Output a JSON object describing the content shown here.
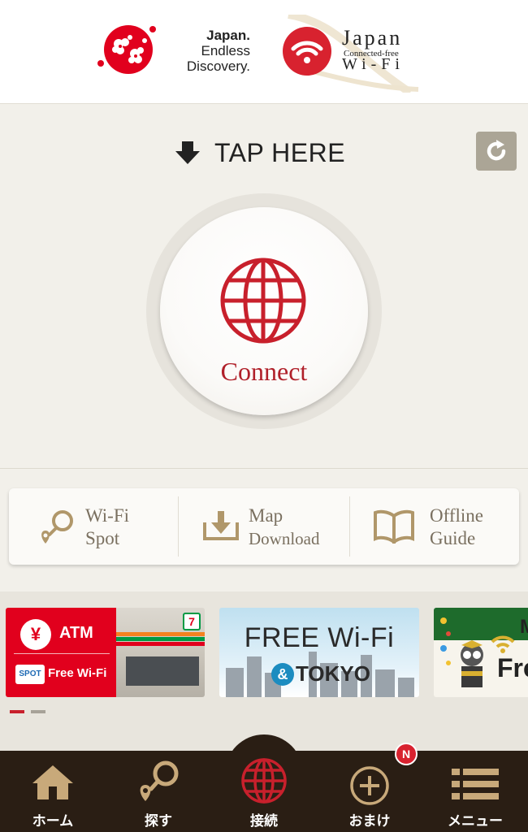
{
  "header": {
    "jed_logo": {
      "line1": "Japan.",
      "line2": "Endless",
      "line3": "Discovery."
    },
    "wifi_logo": {
      "line1": "Japan",
      "line2": "Connected-free",
      "line3": "Wi-Fi"
    }
  },
  "connect": {
    "tap_text": "TAP HERE",
    "button_label": "Connect"
  },
  "menu": {
    "items": [
      {
        "line1": "Wi-Fi",
        "line2": "Spot",
        "icon": "location-search-icon"
      },
      {
        "line1": "Map",
        "line2": "Download",
        "icon": "download-icon"
      },
      {
        "line1": "Offline",
        "line2": "Guide",
        "icon": "book-icon"
      }
    ]
  },
  "banners": [
    {
      "atm": "ATM",
      "yen": "¥",
      "spot": "SPOT",
      "free_wifi": "Free Wi-Fi",
      "seven": "7"
    },
    {
      "title": "FREE Wi-Fi",
      "amp": "&",
      "city": "TOKYO"
    },
    {
      "partial_top": "M",
      "partial_bottom": "Fre"
    }
  ],
  "pager": {
    "count": 2,
    "active": 0
  },
  "tabs": [
    {
      "label": "ホーム",
      "icon": "home-icon"
    },
    {
      "label": "探す",
      "icon": "search-icon"
    },
    {
      "label": "接続",
      "icon": "globe-icon"
    },
    {
      "label": "おまけ",
      "icon": "plus-icon"
    },
    {
      "label": "メニュー",
      "icon": "menu-icon"
    }
  ],
  "badge": {
    "text": "N"
  },
  "colors": {
    "brand_red": "#b0202a",
    "tab_bg": "#2a1e14",
    "menu_text": "#7a7060",
    "page_bg": "#f2f0ea"
  }
}
